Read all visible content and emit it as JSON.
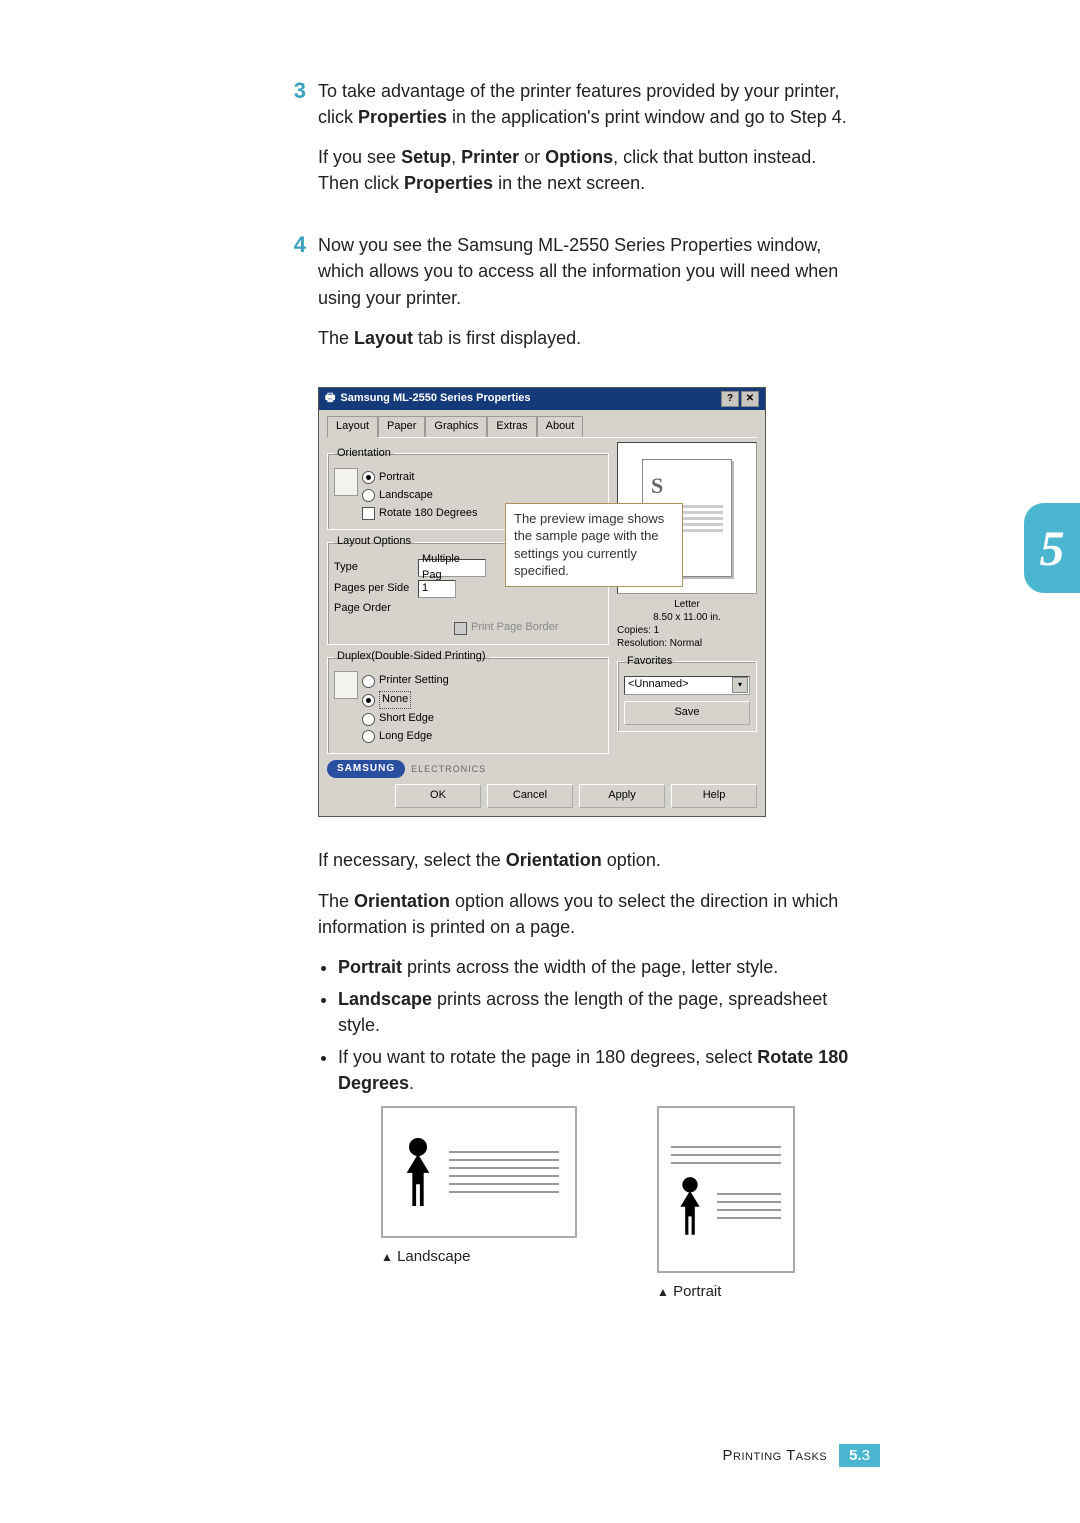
{
  "side_tab": "5",
  "step3": {
    "num": "3",
    "para1_a": "To take advantage of the printer features provided by your printer, click ",
    "para1_b": "Properties",
    "para1_c": " in the application's print window and go to Step 4.",
    "para2_a": "If you see ",
    "para2_b": "Setup",
    "para2_c": ", ",
    "para2_d": "Printer",
    "para2_e": " or ",
    "para2_f": "Options",
    "para2_g": ", click that button instead. Then click ",
    "para2_h": "Properties",
    "para2_i": " in the next screen."
  },
  "step4": {
    "num": "4",
    "para1": "Now you see the Samsung ML-2550 Series Properties window, which allows you to access all the information you will need when using your printer.",
    "para2_a": "The ",
    "para2_b": "Layout",
    "para2_c": " tab is first displayed."
  },
  "dialog": {
    "title": "Samsung ML-2550 Series Properties",
    "tabs": [
      "Layout",
      "Paper",
      "Graphics",
      "Extras",
      "About"
    ],
    "orientation": {
      "legend": "Orientation",
      "portrait": "Portrait",
      "landscape": "Landscape",
      "rotate": "Rotate 180 Degrees"
    },
    "layout_options": {
      "legend": "Layout Options",
      "type_label": "Type",
      "type_value": "Multiple Pag",
      "pps_label": "Pages per Side",
      "pps_value": "1",
      "order_label": "Page Order",
      "border_label": "Print Page Border"
    },
    "duplex": {
      "legend": "Duplex(Double-Sided Printing)",
      "printer_setting": "Printer Setting",
      "none": "None",
      "short": "Short Edge",
      "long": "Long Edge"
    },
    "preview_meta": {
      "l1": "Letter",
      "l2": "8.50 x 11.00 in.",
      "l3": "Copies: 1",
      "l4": "Resolution: Normal"
    },
    "favorites": {
      "legend": "Favorites",
      "value": "<Unnamed>",
      "save": "Save"
    },
    "brand": {
      "name": "SAMSUNG",
      "sub": "ELECTRONICS"
    },
    "buttons": {
      "ok": "OK",
      "cancel": "Cancel",
      "apply": "Apply",
      "help": "Help"
    }
  },
  "callout": "The preview image shows the sample page with the settings you currently specified.",
  "after": {
    "p1_a": "If necessary, select the ",
    "p1_b": "Orientation",
    "p1_c": " option.",
    "p2_a": "The ",
    "p2_b": "Orientation",
    "p2_c": " option allows you to select the direction in which information is printed on a page.",
    "b1_a": "Portrait",
    "b1_b": " prints across the width of the page, letter style.",
    "b2_a": "Landscape",
    "b2_b": " prints across the length of the page, spreadsheet style.",
    "b3_a": "If you want to rotate the page in 180 degrees, select ",
    "b3_b": "Rotate 180 Degrees",
    "b3_c": "."
  },
  "orient_labels": {
    "landscape": "Landscape",
    "portrait": "Portrait",
    "tri": "▲"
  },
  "footer": {
    "section": "Printing Tasks",
    "chapter": "5.",
    "page": "3"
  },
  "chart_data": null
}
